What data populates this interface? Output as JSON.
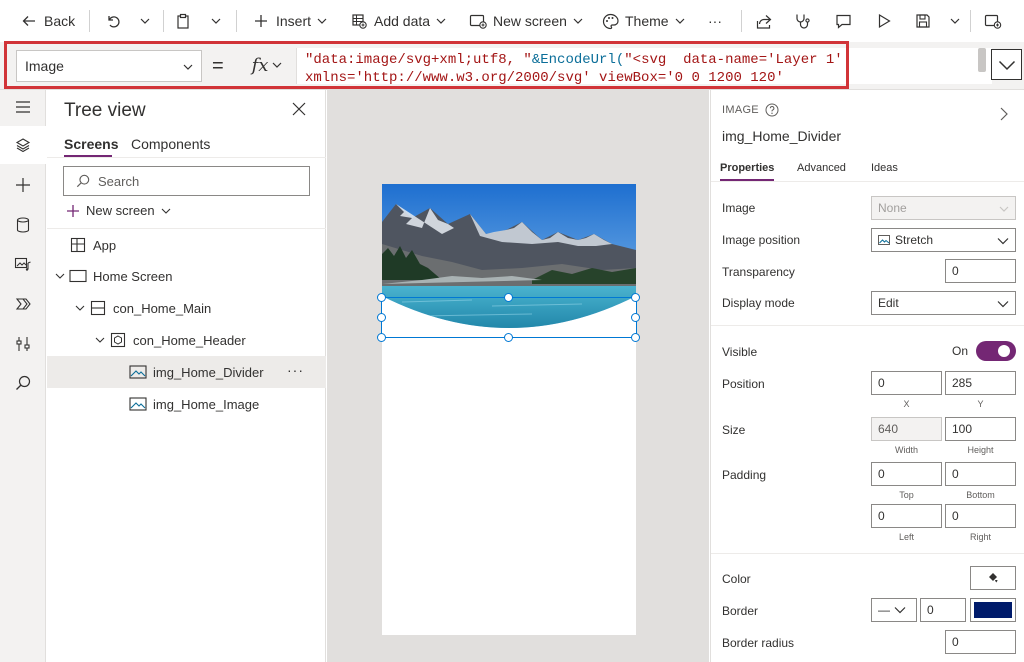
{
  "toolbar": {
    "back": "Back",
    "insert": "Insert",
    "add_data": "Add data",
    "new_screen": "New screen",
    "theme": "Theme",
    "more": "···"
  },
  "formula_bar": {
    "property": "Image",
    "equals": "=",
    "fx": "fx",
    "line1_str": "\"data:image/svg+xml;utf8, \"",
    "line1_fn": "&EncodeUrl(",
    "line1_str2": "\"<svg  data-name='Layer 1'",
    "line2": "xmlns='http://www.w3.org/2000/svg' viewBox='0 0 1200 120'"
  },
  "tree": {
    "title": "Tree view",
    "tab_screens": "Screens",
    "tab_components": "Components",
    "search_placeholder": "Search",
    "new_screen": "New screen",
    "nodes": [
      {
        "label": "App"
      },
      {
        "label": "Home Screen"
      },
      {
        "label": "con_Home_Main"
      },
      {
        "label": "con_Home_Header"
      },
      {
        "label": "img_Home_Divider"
      },
      {
        "label": "img_Home_Image"
      }
    ],
    "more": "···"
  },
  "properties": {
    "kind": "IMAGE",
    "name": "img_Home_Divider",
    "tabs": {
      "properties": "Properties",
      "advanced": "Advanced",
      "ideas": "Ideas"
    },
    "image_label": "Image",
    "image_value": "None",
    "image_position_label": "Image position",
    "image_position_value": "Stretch",
    "transparency_label": "Transparency",
    "transparency_value": "0",
    "display_mode_label": "Display mode",
    "display_mode_value": "Edit",
    "visible_label": "Visible",
    "visible_state": "On",
    "position_label": "Position",
    "position_x": "0",
    "position_y": "285",
    "x_label": "X",
    "y_label": "Y",
    "size_label": "Size",
    "width_value": "640",
    "height_value": "100",
    "width_label": "Width",
    "height_label": "Height",
    "padding_label": "Padding",
    "padding_top": "0",
    "padding_bottom": "0",
    "padding_left": "0",
    "padding_right": "0",
    "top_label": "Top",
    "bottom_label": "Bottom",
    "left_label": "Left",
    "right_label": "Right",
    "color_label": "Color",
    "border_label": "Border",
    "border_style": "—",
    "border_width": "0",
    "border_color": "#001b6b",
    "border_radius_label": "Border radius",
    "border_radius_value": "0"
  },
  "colors": {
    "accent": "#742774",
    "selection": "#0078d4",
    "highlight": "#d13438"
  }
}
